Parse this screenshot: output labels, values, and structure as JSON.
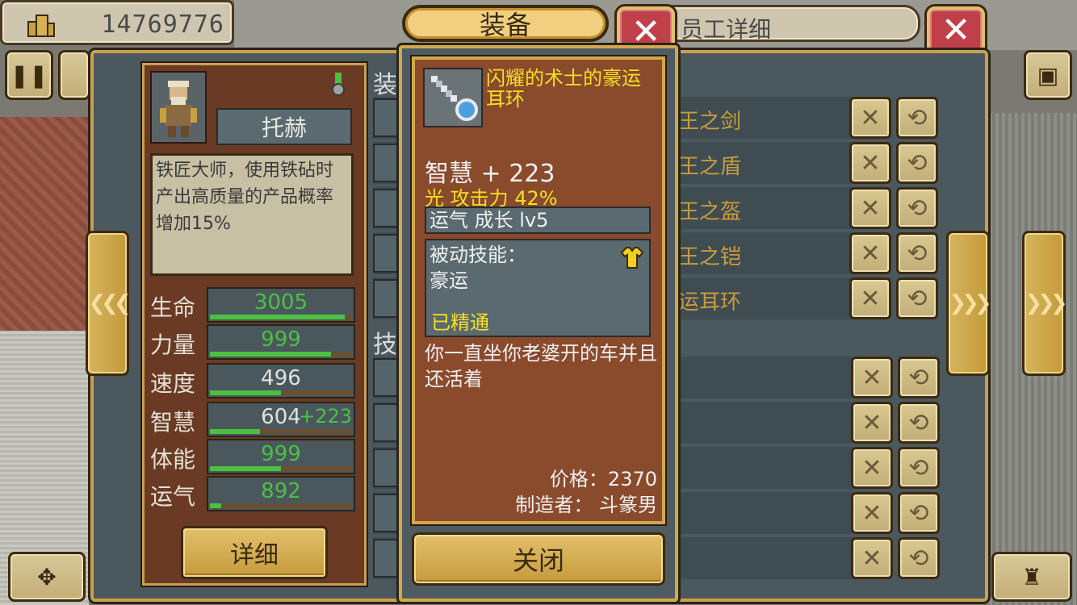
{
  "top_bar": {
    "money_icon": "building-icon",
    "money": "14769776",
    "staff_title": "员工详细"
  },
  "popup": {
    "title": "装备",
    "item_name": "闪耀的术士的豪运耳环",
    "main_stat": "智慧 + 223",
    "sub_stat": "光 攻击力 42%",
    "growth": "运气 成长 lv5",
    "skill_label": "被动技能：",
    "skill_name": "豪运",
    "skill_mastery": "已精通",
    "flavor": "你一直坐你老婆开的车并且还活着",
    "price": "价格：2370",
    "maker": "制造者： 斗篆男",
    "close_label": "关闭"
  },
  "character": {
    "name": "托赫",
    "description": "铁匠大师，使用铁砧时产出高质量的产品概率增加15%",
    "stats": [
      {
        "label": "生命",
        "value": "3005",
        "bonus": "",
        "fill": 0.95,
        "color": "#4cc040"
      },
      {
        "label": "力量",
        "value": "999",
        "bonus": "",
        "fill": 0.85,
        "color": "#4cc040"
      },
      {
        "label": "速度",
        "value": "496",
        "bonus": "",
        "fill": 0.5,
        "color": "#e0e0e0"
      },
      {
        "label": "智慧",
        "value": "604",
        "bonus": "+223",
        "fill": 0.35,
        "color": "#e0e0e0"
      },
      {
        "label": "体能",
        "value": "999",
        "bonus": "",
        "fill": 0.5,
        "color": "#4cc040"
      },
      {
        "label": "运气",
        "value": "892",
        "bonus": "",
        "fill": 0.08,
        "color": "#4cc040"
      }
    ],
    "detail_button": "详细"
  },
  "equipment": {
    "section_equip": "装",
    "section_skill": "技",
    "items": [
      "王之剑",
      "王之盾",
      "王之盔",
      "王之铠",
      "运耳环"
    ]
  }
}
